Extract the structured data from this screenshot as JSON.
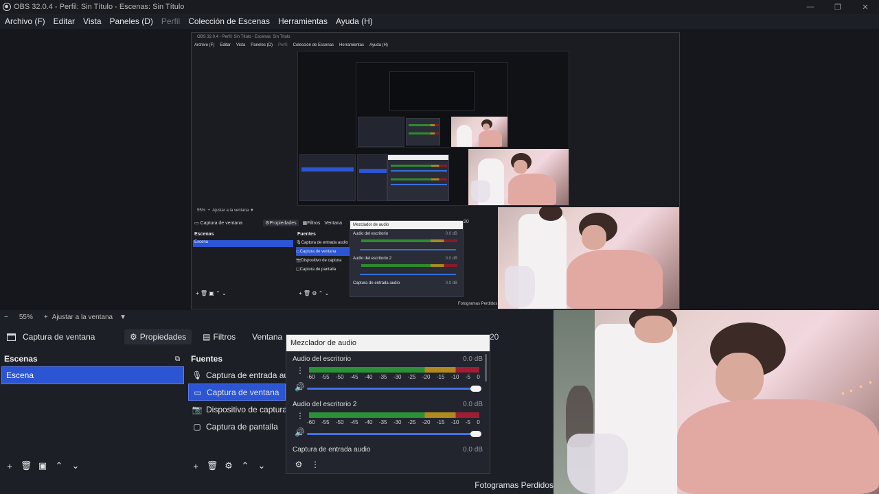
{
  "window": {
    "title": "OBS 32.0.4 - Perfil: Sin Título - Escenas: Sin Título",
    "minimize": "—",
    "maximize": "❐",
    "close": "✕"
  },
  "menu": [
    {
      "label": "Archivo (F)",
      "enabled": true
    },
    {
      "label": "Editar",
      "enabled": true
    },
    {
      "label": "Vista",
      "enabled": true
    },
    {
      "label": "Paneles (D)",
      "enabled": true
    },
    {
      "label": "Perfil",
      "enabled": false
    },
    {
      "label": "Colección de Escenas",
      "enabled": true
    },
    {
      "label": "Herramientas",
      "enabled": true
    },
    {
      "label": "Ayuda (H)",
      "enabled": true
    }
  ],
  "zoom": {
    "minus": "−",
    "value": "55%",
    "plus": "+",
    "fit_label": "Ajustar a la ventana",
    "dropdown": "▼"
  },
  "context": {
    "source_label": "Captura de ventana",
    "properties_label": "Propiedades",
    "filters_label": "Filtros",
    "window_label": "Ventana",
    "behind_text": "20"
  },
  "scenes": {
    "header": "Escenas",
    "items": [
      "Escena"
    ]
  },
  "sources": {
    "header": "Fuentes",
    "items": [
      {
        "label": "Captura de entrada audio",
        "icon": "microphone-icon",
        "glyph": "🎙",
        "selected": false
      },
      {
        "label": "Captura de ventana",
        "icon": "window-icon",
        "glyph": "▭",
        "selected": true
      },
      {
        "label": "Dispositivo de captura de video",
        "icon": "camera-icon",
        "glyph": "📷",
        "selected": false
      },
      {
        "label": "Captura de pantalla",
        "icon": "monitor-icon",
        "glyph": "▢",
        "selected": false
      }
    ]
  },
  "mixer": {
    "title": "Mezclador de audio",
    "channels": [
      {
        "name": "Audio del escritorio",
        "db": "0.0 dB"
      },
      {
        "name": "Audio del escritorio 2",
        "db": "0.0 dB"
      },
      {
        "name": "Captura de entrada audio",
        "db": "0.0 dB"
      }
    ],
    "scale": [
      "-60",
      "-55",
      "-50",
      "-45",
      "-40",
      "-35",
      "-30",
      "-25",
      "-20",
      "-15",
      "-10",
      "-5",
      "0"
    ]
  },
  "status": {
    "dropped_frames": "Fotogramas Perdidos"
  },
  "nested": {
    "title": "OBS 32.0.4 - Perfil: Sin Título - Escenas: Sin Título",
    "menu": [
      "Archivo (F)",
      "Editar",
      "Vista",
      "Paneles (D)",
      "Perfil",
      "Colección de Escenas",
      "Herramientas",
      "Ayuda (H)"
    ],
    "zoom": "55%",
    "fit": "Ajustar a la ventana",
    "source": "Captura de ventana",
    "properties": "Propiedades",
    "filters": "Filtros",
    "window": "Ventana",
    "scenes": "Escenas",
    "scene": "Escena",
    "sources": "Fuentes",
    "src1": "Captura de entrada audio",
    "src2": "Captura de ventana",
    "src3": "Dispositivo de captura",
    "src4": "Captura de pantalla",
    "mixer": "Mezclador de audio",
    "ch1": "Audio del escritorio",
    "ch2": "Audio del escritorio 2",
    "ch3": "Captura de entrada audio",
    "db": "0.0 dB",
    "dropped": "Fotogramas Perdidos",
    "number": "20"
  },
  "colors": {
    "background": "#1d1f26",
    "selection": "#2c55d4",
    "meter_green": "#2c9036",
    "meter_yellow": "#b08a1e",
    "meter_red": "#a01d34",
    "slider": "#3f73e6"
  }
}
